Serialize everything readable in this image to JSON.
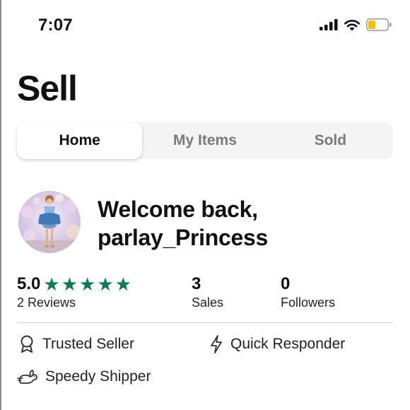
{
  "status_bar": {
    "time": "7:07",
    "icons": [
      "cellular-signal-icon",
      "wifi-icon",
      "battery-icon"
    ],
    "battery_color": "#f2c200"
  },
  "page": {
    "title": "Sell"
  },
  "tabs": [
    {
      "label": "Home",
      "active": true
    },
    {
      "label": "My Items",
      "active": false
    },
    {
      "label": "Sold",
      "active": false
    }
  ],
  "profile": {
    "welcome_line1": "Welcome back,",
    "welcome_line2": "parlay_Princess"
  },
  "stats": {
    "rating": "5.0",
    "stars": 5,
    "star_color": "#0c7a55",
    "reviews": "2 Reviews",
    "sales_value": "3",
    "sales_label": "Sales",
    "followers_value": "0",
    "followers_label": "Followers"
  },
  "badges": {
    "trusted": {
      "label": "Trusted Seller",
      "icon": "award-ribbon-icon"
    },
    "quick": {
      "label": "Quick Responder",
      "icon": "lightning-icon"
    },
    "speedy": {
      "label": "Speedy Shipper",
      "icon": "rabbit-icon"
    }
  }
}
